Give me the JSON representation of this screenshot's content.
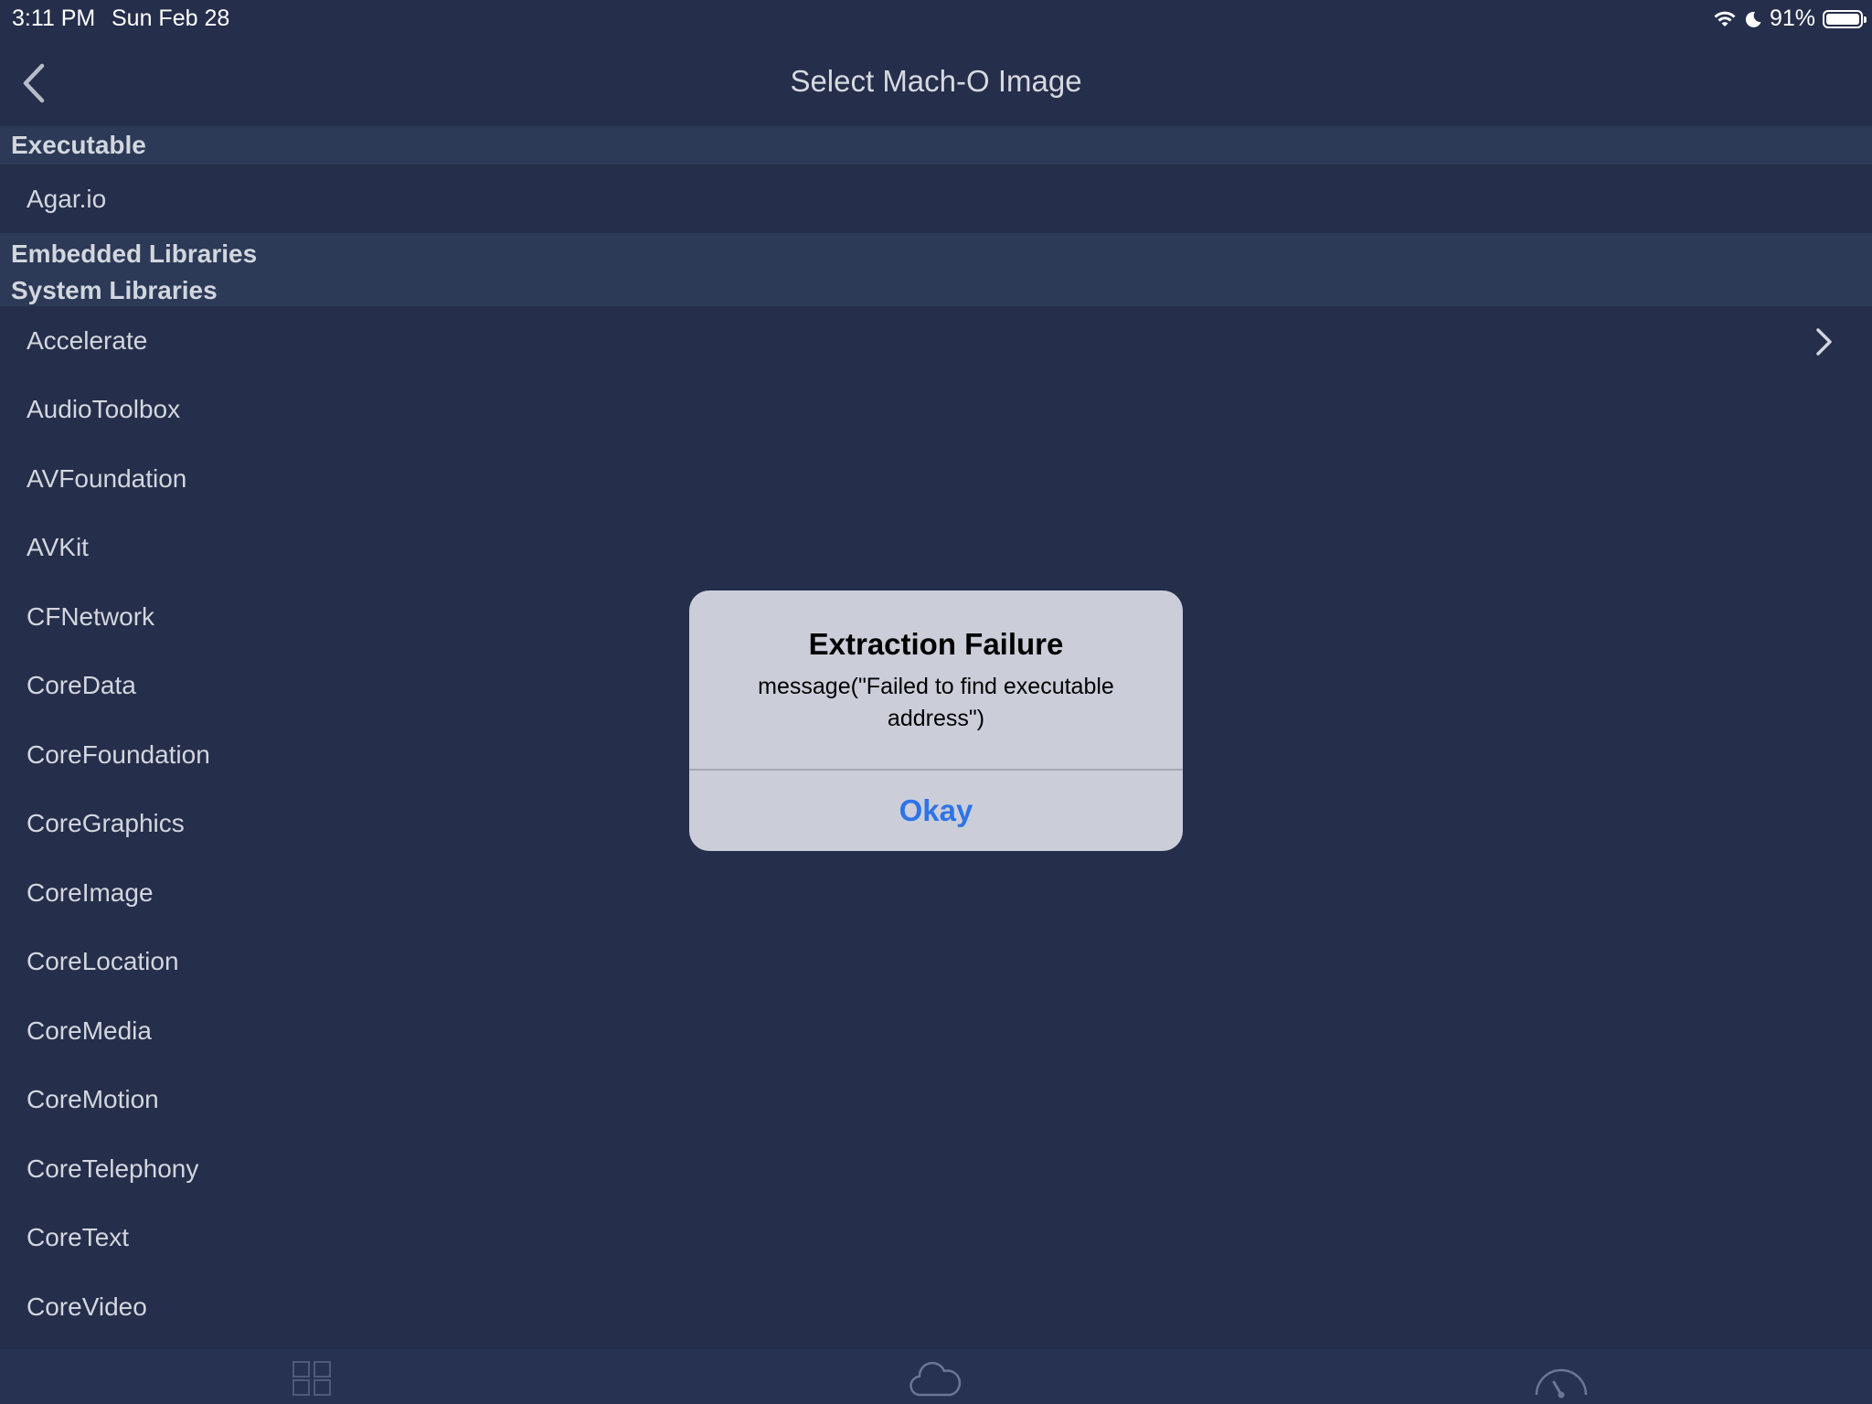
{
  "status_bar": {
    "time": "3:11 PM",
    "date": "Sun Feb 28",
    "battery": "91%",
    "icons": [
      "wifi-icon",
      "moon-icon",
      "battery-icon"
    ]
  },
  "nav": {
    "title": "Select Mach-O Image",
    "back_icon": "chevron-left-icon"
  },
  "sections": {
    "executable": "Executable",
    "embedded": "Embedded Libraries",
    "system": "System Libraries"
  },
  "executable_items": [
    "Agar.io"
  ],
  "system_items": [
    "Accelerate",
    "AudioToolbox",
    "AVFoundation",
    "AVKit",
    "CFNetwork",
    "CoreData",
    "CoreFoundation",
    "CoreGraphics",
    "CoreImage",
    "CoreLocation",
    "CoreMedia",
    "CoreMotion",
    "CoreTelephony",
    "CoreText",
    "CoreVideo"
  ],
  "alert": {
    "title": "Extraction Failure",
    "message": "message(\"Failed to find executable address\")",
    "button": "Okay"
  },
  "tab_bar": {
    "icons": [
      "grid-icon",
      "cloud-icon",
      "gauge-icon"
    ]
  },
  "colors": {
    "background": "#252e4a",
    "section_header": "#2c3a57",
    "alert_bg": "#cbced9",
    "accent": "#2f74e6"
  }
}
